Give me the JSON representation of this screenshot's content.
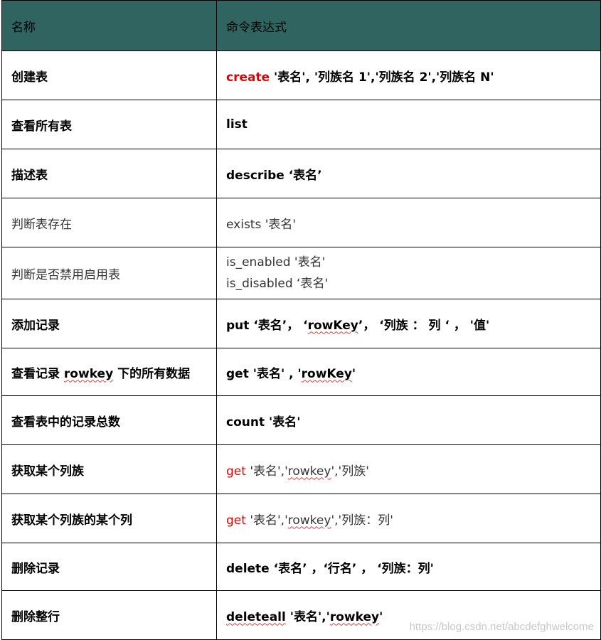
{
  "header": {
    "name": "名称",
    "command": "命令表达式"
  },
  "rows": [
    {
      "name": "创建表",
      "bold": true,
      "cmd_keyword": "create",
      "cmd_args": " '表名', '列族名 1','列族名 2','列族名 N'"
    },
    {
      "name": "查看所有表",
      "bold": true,
      "cmd": "list"
    },
    {
      "name": "描述表",
      "bold": true,
      "cmd": "describe    ‘表名’"
    },
    {
      "name": "判断表存在",
      "bold": false,
      "cmd": "exists    '表名'"
    },
    {
      "name": "判断是否禁用启用表",
      "bold": false,
      "cmd_line1": "is_enabled '表名'",
      "cmd_line2": "is_disabled ‘表名'"
    },
    {
      "name": "添加记录",
      "bold": true,
      "cmd_a": "put    ‘表名’，  ‘",
      "cmd_b": "rowKey",
      "cmd_c": "’，  ‘列族 ： 列 ‘    ，  '值'"
    },
    {
      "name_a": "查看记录 ",
      "name_b": "rowkey",
      "name_c": " 下的所有数据",
      "bold": true,
      "cmd_a": "get    '表名' , '",
      "cmd_b": "rowKey",
      "cmd_c": "'"
    },
    {
      "name": "查看表中的记录总数",
      "bold": true,
      "cmd": "count    '表名'"
    },
    {
      "name": "获取某个列族",
      "bold": true,
      "cmd_keyword": "get",
      "cmd_a": " '表名','",
      "cmd_b": "rowkey",
      "cmd_c": "','列族'"
    },
    {
      "name": "获取某个列族的某个列",
      "bold": true,
      "cmd_keyword": "get",
      "cmd_a": " '表名','",
      "cmd_b": "rowkey",
      "cmd_c": "','列族：列'"
    },
    {
      "name": "删除记录",
      "bold": true,
      "cmd": "delete    ‘表名’ ，‘行名’  ，  ‘列族：列'"
    },
    {
      "name": "删除整行",
      "bold": true,
      "cmd_a": "",
      "cmd_b": "deleteall",
      "cmd_c": " '表名','",
      "cmd_d": "rowkey",
      "cmd_e": "'"
    }
  ],
  "watermark": "https://blog.csdn.net/abcdefghwelcome",
  "colors": {
    "header_bg": "#2f6460",
    "keyword_red": "#e00000",
    "border": "#000000"
  }
}
